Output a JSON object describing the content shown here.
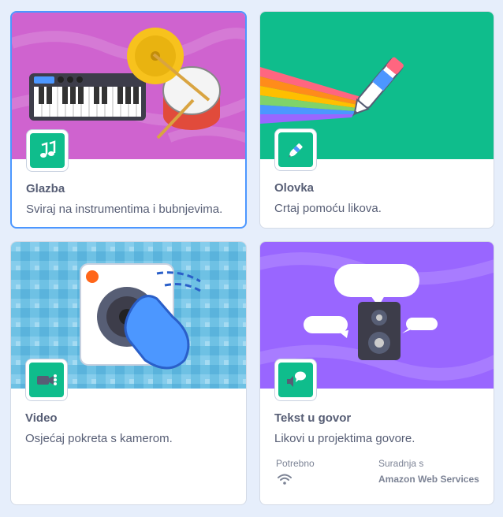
{
  "extensions": [
    {
      "title": "Glazba",
      "description": "Sviraj na instrumentima i bubnjevima.",
      "icon": "music-notes-icon",
      "banner_color": "#cf63cf",
      "selected": true
    },
    {
      "title": "Olovka",
      "description": "Crtaj pomoću likova.",
      "icon": "pen-icon",
      "banner_color": "#0fbd8c",
      "selected": false
    },
    {
      "title": "Video",
      "description": "Osjećaj pokreta s kamerom.",
      "icon": "video-camera-icon",
      "banner_color": "#5cb1d6",
      "selected": false
    },
    {
      "title": "Tekst u govor",
      "description": "Likovi u projektima govore.",
      "icon": "speech-icon",
      "banner_color": "#9966ff",
      "selected": false,
      "requires_label": "Potrebno",
      "requires_icon": "wifi-icon",
      "collaboration_label": "Suradnja s",
      "collaboration_value": "Amazon Web Services"
    }
  ],
  "colors": {
    "accent": "#4c97ff",
    "extension_green": "#0fbd8c",
    "text": "#575e75",
    "background": "#e6eefb"
  }
}
